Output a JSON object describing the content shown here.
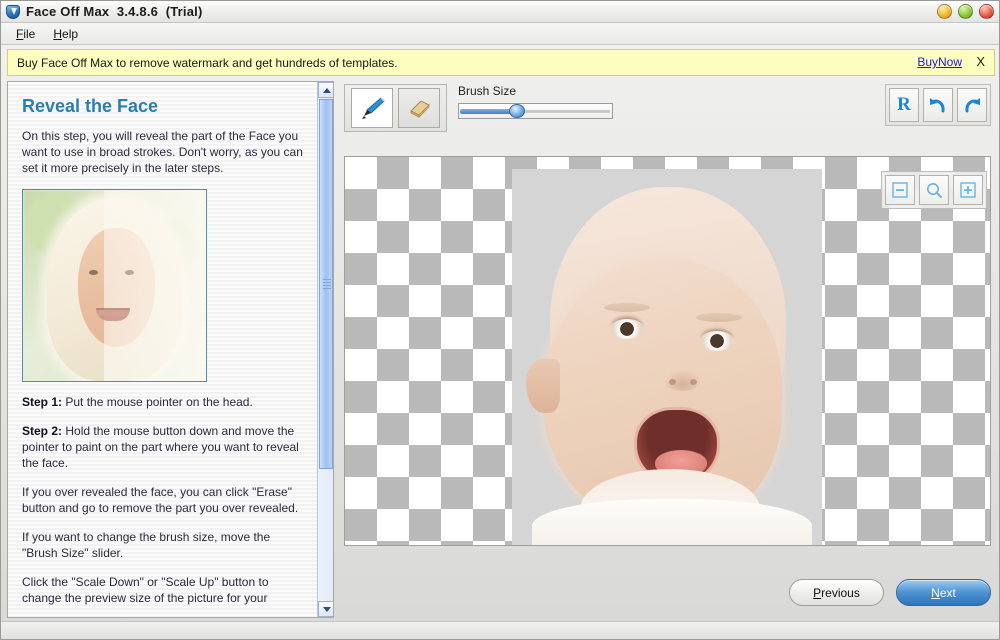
{
  "window": {
    "title": "Face Off Max  3.4.8.6  (Trial)",
    "icon": "shield-face-icon",
    "controls": {
      "minimize": "minimize-button",
      "maximize": "maximize-button",
      "close": "close-button"
    }
  },
  "menu": {
    "items": [
      {
        "label": "File",
        "accel": "F"
      },
      {
        "label": "Help",
        "accel": "H"
      }
    ]
  },
  "banner": {
    "text": "Buy Face Off Max to remove watermark and get hundreds of templates.",
    "link_label": "BuyNow",
    "close_label": "X",
    "background_color": "#fdfdc0",
    "link_color": "#1a1ae0"
  },
  "sidebar": {
    "title": "Reveal the Face",
    "title_color": "#2b7fad",
    "intro": "On this step, you will reveal the part of the Face you want to use in broad strokes. Don't worry, as you can set it more precisely in the later steps.",
    "thumbnail_alt": "preview-girl-face",
    "paragraphs": [
      {
        "lead": "Step 1:",
        "text": " Put the mouse pointer on the head."
      },
      {
        "lead": "Step 2:",
        "text": " Hold the mouse button down and move the pointer to paint on the part where you want to reveal the face."
      },
      {
        "lead": "",
        "text": "If you over revealed the face, you can click \"Erase\" button and go to remove the part you over revealed."
      },
      {
        "lead": "",
        "text": "If you want to change the brush size, move the \"Brush Size\" slider."
      },
      {
        "lead": "",
        "text": "Click the \"Scale Down\" or \"Scale Up\" button to change the preview size of the picture for your"
      }
    ],
    "scrollbar": {
      "up_arrow": "scroll-up-arrow",
      "down_arrow": "scroll-down-arrow"
    }
  },
  "toolbar": {
    "brush_tool": "brush-tool",
    "eraser_tool": "eraser-tool",
    "active_tool": "brush",
    "brush_size_label": "Brush Size",
    "brush_size_percent": 36,
    "history": [
      {
        "name": "reset-button",
        "glyph": "R"
      },
      {
        "name": "undo-button",
        "glyph": "undo"
      },
      {
        "name": "redo-button",
        "glyph": "redo"
      }
    ]
  },
  "canvas": {
    "image_alt": "baby-face-photo",
    "background": "transparent-checkerboard",
    "brush_cursor": "brush-circle-cursor",
    "zoom_controls": [
      {
        "name": "scale-down-button",
        "glyph": "minus"
      },
      {
        "name": "zoom-fit-button",
        "glyph": "magnifier"
      },
      {
        "name": "scale-up-button",
        "glyph": "plus"
      }
    ]
  },
  "footer": {
    "previous_label": "Previous",
    "previous_accel": "P",
    "next_label": "Next",
    "next_accel": "N",
    "next_accent_color": "#4f94d4"
  }
}
